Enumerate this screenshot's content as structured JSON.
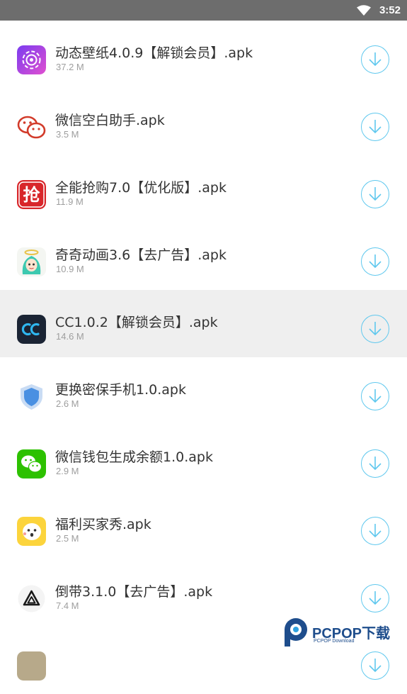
{
  "status_bar": {
    "time": "3:52",
    "wifi_icon": "wifi-icon"
  },
  "files": [
    {
      "name": "动态壁纸4.0.9【解锁会员】.apk",
      "size": "37.2 M",
      "icon": "live-wallpaper-app-icon"
    },
    {
      "name": "微信空白助手.apk",
      "size": "3.5 M",
      "icon": "wechat-blank-helper-app-icon"
    },
    {
      "name": "全能抢购7.0【优化版】.apk",
      "size": "11.9 M",
      "icon": "flash-sale-app-icon"
    },
    {
      "name": "奇奇动画3.6【去广告】.apk",
      "size": "10.9 M",
      "icon": "anime-app-icon"
    },
    {
      "name": "CC1.0.2【解锁会员】.apk",
      "size": "14.6 M",
      "icon": "cc-app-icon",
      "selected": true
    },
    {
      "name": "更换密保手机1.0.apk",
      "size": "2.6 M",
      "icon": "shield-app-icon"
    },
    {
      "name": "微信钱包生成余额1.0.apk",
      "size": "2.9 M",
      "icon": "wechat-wallet-app-icon"
    },
    {
      "name": "福利买家秀.apk",
      "size": "2.5 M",
      "icon": "buyer-show-app-icon"
    },
    {
      "name": "倒带3.1.0【去广告】.apk",
      "size": "7.4 M",
      "icon": "rewind-app-icon"
    },
    {
      "name": "",
      "size": "",
      "icon": "partial-app-icon"
    }
  ],
  "download_icon": "download-icon",
  "watermark": {
    "text": "PCPOP下载",
    "sub": "PCPOP Download"
  },
  "colors": {
    "status_bar": "#6d6d6d",
    "accent": "#5fc8ee",
    "selected_row": "#efefef"
  }
}
